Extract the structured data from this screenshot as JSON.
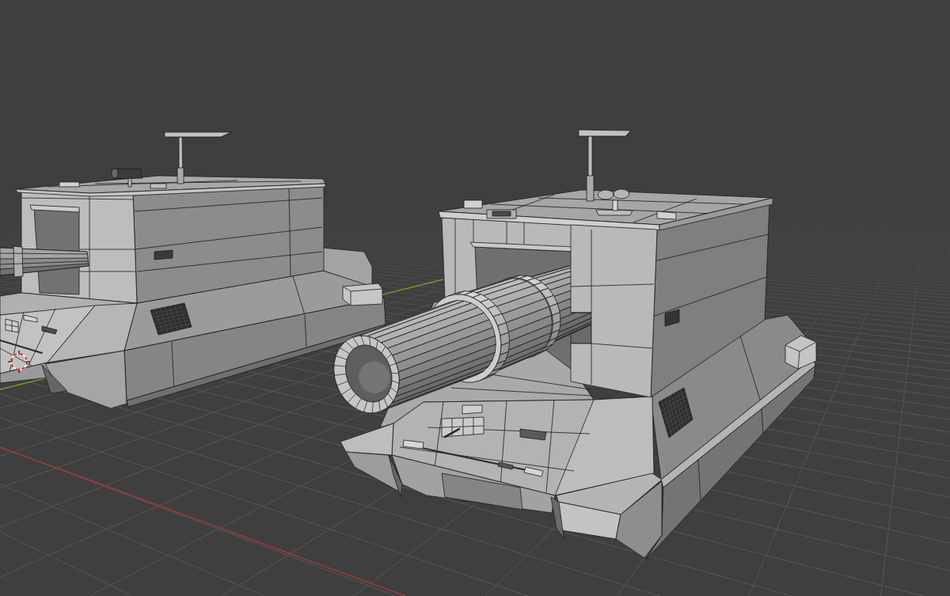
{
  "viewport": {
    "floor_grid": true,
    "axes": [
      {
        "kind": "x",
        "color": "#a33b3b"
      },
      {
        "kind": "y",
        "color": "#6e9a2c"
      }
    ],
    "objects": [
      {
        "kind": "vehicle"
      },
      {
        "kind": "vehicle"
      }
    ],
    "wireframe": true,
    "cursor_3d": true
  }
}
